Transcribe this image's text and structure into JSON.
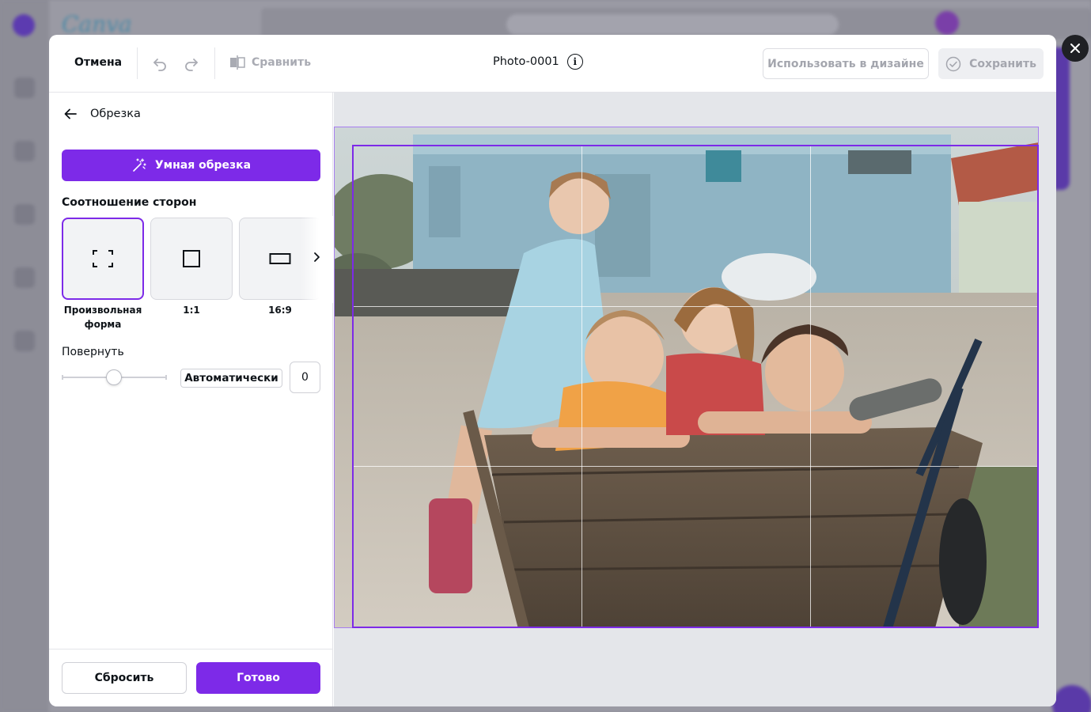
{
  "header": {
    "cancel_label": "Отмена",
    "compare_label": "Сравнить",
    "title": "Photo-0001",
    "use_in_design_label": "Использовать в дизайне",
    "save_label": "Сохранить"
  },
  "panel": {
    "back_title": "Обрезка",
    "smart_crop_label": "Умная обрезка",
    "aspect_ratio_label": "Соотношение сторон",
    "ratios": [
      {
        "label_line1": "Произвольная",
        "label_line2": "форма",
        "selected": true
      },
      {
        "label_line1": "1:1",
        "label_line2": "",
        "selected": false
      },
      {
        "label_line1": "16:9",
        "label_line2": "",
        "selected": false
      }
    ],
    "rotate_label": "Повернуть",
    "auto_label": "Автоматически",
    "rotate_value": "0",
    "reset_label": "Сбросить",
    "done_label": "Готово"
  },
  "icons": {
    "close": "close-icon",
    "undo": "undo-icon",
    "redo": "redo-icon",
    "compare": "compare-icon",
    "info": "info-icon",
    "check": "check-circle-icon",
    "back": "arrow-left-icon",
    "magic": "magic-wand-icon",
    "chevron": "chevron-right-icon"
  },
  "colors": {
    "accent": "#7d2ae8",
    "disabled_text": "#a4a6ae",
    "canvas_bg": "#e4e6ea",
    "overlay_close": "#1f2024"
  }
}
